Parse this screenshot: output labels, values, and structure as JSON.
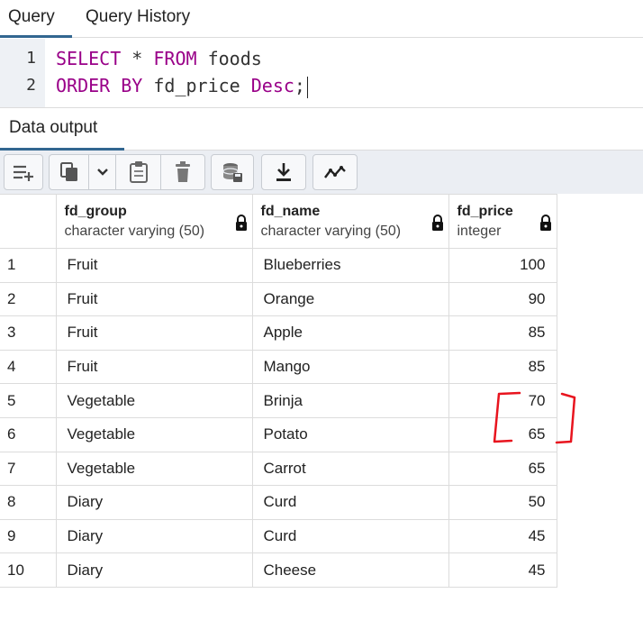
{
  "tabs": {
    "query": "Query",
    "history": "Query History"
  },
  "editor": {
    "line_numbers": [
      "1",
      "2"
    ],
    "line1": {
      "kw1": "SELECT",
      "rest1": " * ",
      "kw2": "FROM",
      "rest2": " foods"
    },
    "line2": {
      "kw1": "ORDER BY",
      "rest1": " fd_price ",
      "kw2": "Desc",
      "rest2": ";"
    }
  },
  "output": {
    "tab_label": "Data output"
  },
  "toolbar": {
    "icons": [
      "add-row-icon",
      "copy-icon",
      "chevron-down-icon",
      "paste-icon",
      "delete-icon",
      "save-data-icon",
      "download-icon",
      "graph-icon"
    ]
  },
  "table": {
    "columns": [
      {
        "name": "fd_group",
        "type": "character varying (50)"
      },
      {
        "name": "fd_name",
        "type": "character varying (50)"
      },
      {
        "name": "fd_price",
        "type": "integer"
      }
    ],
    "rows": [
      {
        "n": "1",
        "group": "Fruit",
        "name": "Blueberries",
        "price": "100"
      },
      {
        "n": "2",
        "group": "Fruit",
        "name": "Orange",
        "price": "90"
      },
      {
        "n": "3",
        "group": "Fruit",
        "name": "Apple",
        "price": "85"
      },
      {
        "n": "4",
        "group": "Fruit",
        "name": "Mango",
        "price": "85"
      },
      {
        "n": "5",
        "group": "Vegetable",
        "name": "Brinja",
        "price": "70"
      },
      {
        "n": "6",
        "group": "Vegetable",
        "name": "Potato",
        "price": "65"
      },
      {
        "n": "7",
        "group": "Vegetable",
        "name": "Carrot",
        "price": "65"
      },
      {
        "n": "8",
        "group": "Diary",
        "name": "Curd",
        "price": "50"
      },
      {
        "n": "9",
        "group": "Diary",
        "name": "Curd",
        "price": "45"
      },
      {
        "n": "10",
        "group": "Diary",
        "name": "Cheese",
        "price": "45"
      }
    ]
  },
  "colors": {
    "accent": "#326690",
    "keyword": "#990088",
    "annotation": "#e8141e"
  }
}
